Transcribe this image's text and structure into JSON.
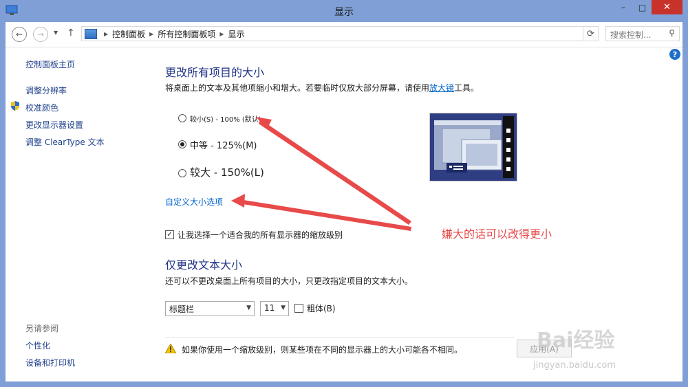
{
  "window": {
    "title": "显示",
    "minimize": "–",
    "maximize": "□",
    "close": "✕"
  },
  "address": {
    "breadcrumbs": [
      "控制面板",
      "所有控制面板项",
      "显示"
    ],
    "search_placeholder": "搜索控制...",
    "separator": "▶"
  },
  "sidebar": {
    "home": "控制面板主页",
    "items": [
      "调整分辨率",
      "校准颜色",
      "更改显示器设置",
      "调整 ClearType 文本"
    ],
    "see_also_label": "另请参阅",
    "see_also": [
      "个性化",
      "设备和打印机"
    ]
  },
  "main": {
    "heading": "更改所有项目的大小",
    "description_prefix": "将桌面上的文本及其他项缩小和增大。若要临时仅放大部分屏幕，请使用",
    "magnifier_link": "放大镜",
    "description_suffix": "工具。",
    "options": [
      {
        "label": "较小(S) - 100% (默认)",
        "selected": false
      },
      {
        "label": "中等 - 125%(M)",
        "selected": true
      },
      {
        "label": "较大 - 150%(L)",
        "selected": false
      }
    ],
    "custom_link": "自定义大小选项",
    "scaling_checkbox_label": "让我选择一个适合我的所有显示器的缩放级别",
    "scaling_checked": true,
    "text_heading": "仅更改文本大小",
    "text_description": "还可以不更改桌面上所有项目的大小，只更改指定项目的文本大小。",
    "item_select": "标题栏",
    "size_select": "11",
    "bold_label": "粗体(B)",
    "bold_checked": false,
    "warning": "如果你使用一个缩放级别，则某些项在不同的显示器上的大小可能各不相同。",
    "apply_button": "应用(A)"
  },
  "annotation": {
    "text": "嫌大的话可以改得更小",
    "color": "#e84a4a"
  },
  "watermark": {
    "brand": "Bai经验",
    "url": "jingyan.baidu.com"
  }
}
